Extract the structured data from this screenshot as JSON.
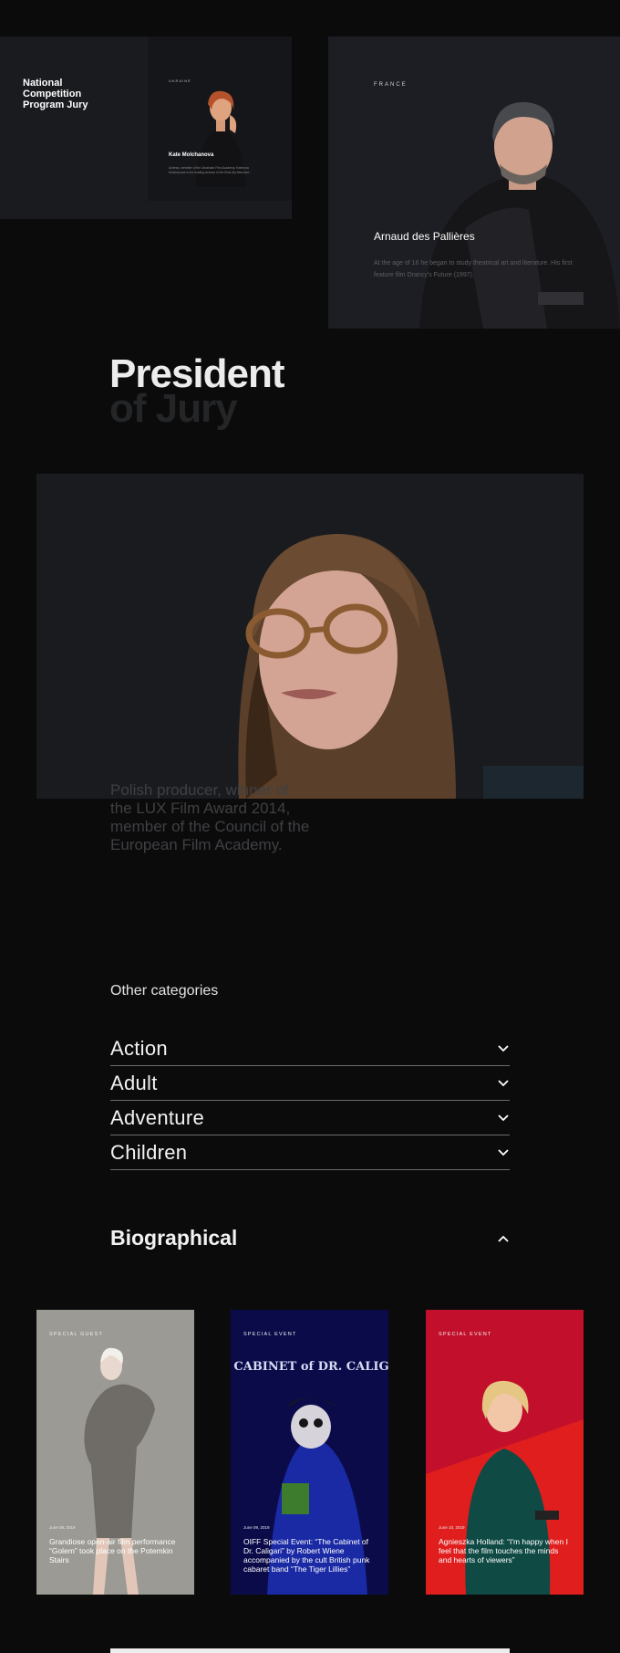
{
  "jury_cards": {
    "national": {
      "title": "National Competition Program Jury",
      "mini": {
        "country": "UKRAINE",
        "name": "Kate Molchanova",
        "bio": "Actress, member of the Ukrainian Film Academy. Kateryna Molchanova is the leading actress in the films My Mermaid..."
      }
    },
    "arnaud": {
      "country": "FRANCE",
      "name": "Arnaud des Pallières",
      "bio": "At the age of 16 he began to study theatrical art and literature. His first feature film Drancy's Future (1997)."
    }
  },
  "president": {
    "line1": "President",
    "line2": "of Jury",
    "description": "Polish producer, winner of the LUX Film Award 2014, member of the Council of the European Film Academy."
  },
  "categories": {
    "heading": "Other categories",
    "items": [
      {
        "label": "Action"
      },
      {
        "label": "Adult"
      },
      {
        "label": "Adventure"
      },
      {
        "label": "Children"
      }
    ],
    "open_category": "Biographical"
  },
  "events": [
    {
      "tag": "SPECIAL GUEST",
      "date": "June 08, 2019",
      "text": "Grandiose open-air film performance “Golem” took place on the Potemkin Stairs",
      "bg": "#9b9a94"
    },
    {
      "tag": "SPECIAL EVENT",
      "date": "June 09, 2019",
      "text": "OIFF Special Event: “The Cabinet of Dr. Caligari” by Robert Wiene accompanied by the cult British punk cabaret band “The Tiger Lillies”",
      "bg": "#0b0b4a",
      "poster": "The CABINET of DR. CALIGARI"
    },
    {
      "tag": "SPECIAL EVENT",
      "date": "June 10, 2019",
      "text": "Agnieszka Holland: “I'm happy when I feel that the film touches the minds and hearts of viewers”",
      "bg": "#c2102c"
    }
  ]
}
